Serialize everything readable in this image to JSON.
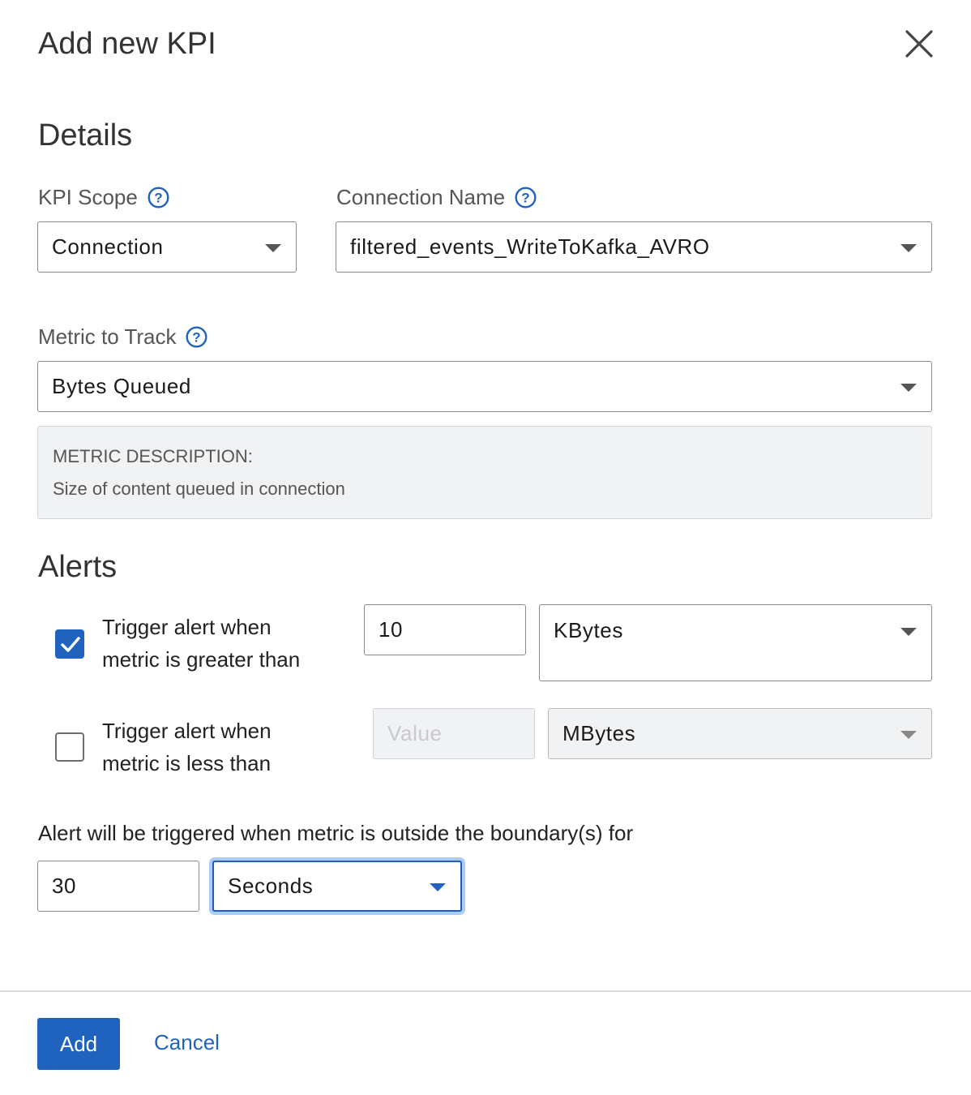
{
  "dialog": {
    "title": "Add new KPI",
    "close_icon": "close-icon"
  },
  "details": {
    "heading": "Details",
    "kpi_scope": {
      "label": "KPI Scope",
      "value": "Connection",
      "help_icon": "help-circle-icon"
    },
    "connection_name": {
      "label": "Connection Name",
      "value": "filtered_events_WriteToKafka_AVRO",
      "help_icon": "help-circle-icon"
    },
    "metric": {
      "label": "Metric to Track",
      "value": "Bytes Queued",
      "help_icon": "help-circle-icon"
    },
    "description": {
      "label": "METRIC DESCRIPTION:",
      "text": "Size of content queued in connection"
    }
  },
  "alerts": {
    "heading": "Alerts",
    "greater": {
      "checked": true,
      "label_line1": "Trigger alert when",
      "label_line2": "metric is greater than",
      "value": "10",
      "unit": "KBytes"
    },
    "less": {
      "checked": false,
      "label_line1": "Trigger alert when",
      "label_line2": "metric is less than",
      "placeholder": "Value",
      "unit": "MBytes"
    },
    "boundary_text": "Alert will be triggered when metric is outside the boundary(s) for",
    "duration_value": "30",
    "duration_unit": "Seconds"
  },
  "footer": {
    "add_label": "Add",
    "cancel_label": "Cancel"
  },
  "colors": {
    "accent": "#1f63bf",
    "focus_ring": "#a9cdf4",
    "disabled_bg": "#f1f2f4"
  }
}
